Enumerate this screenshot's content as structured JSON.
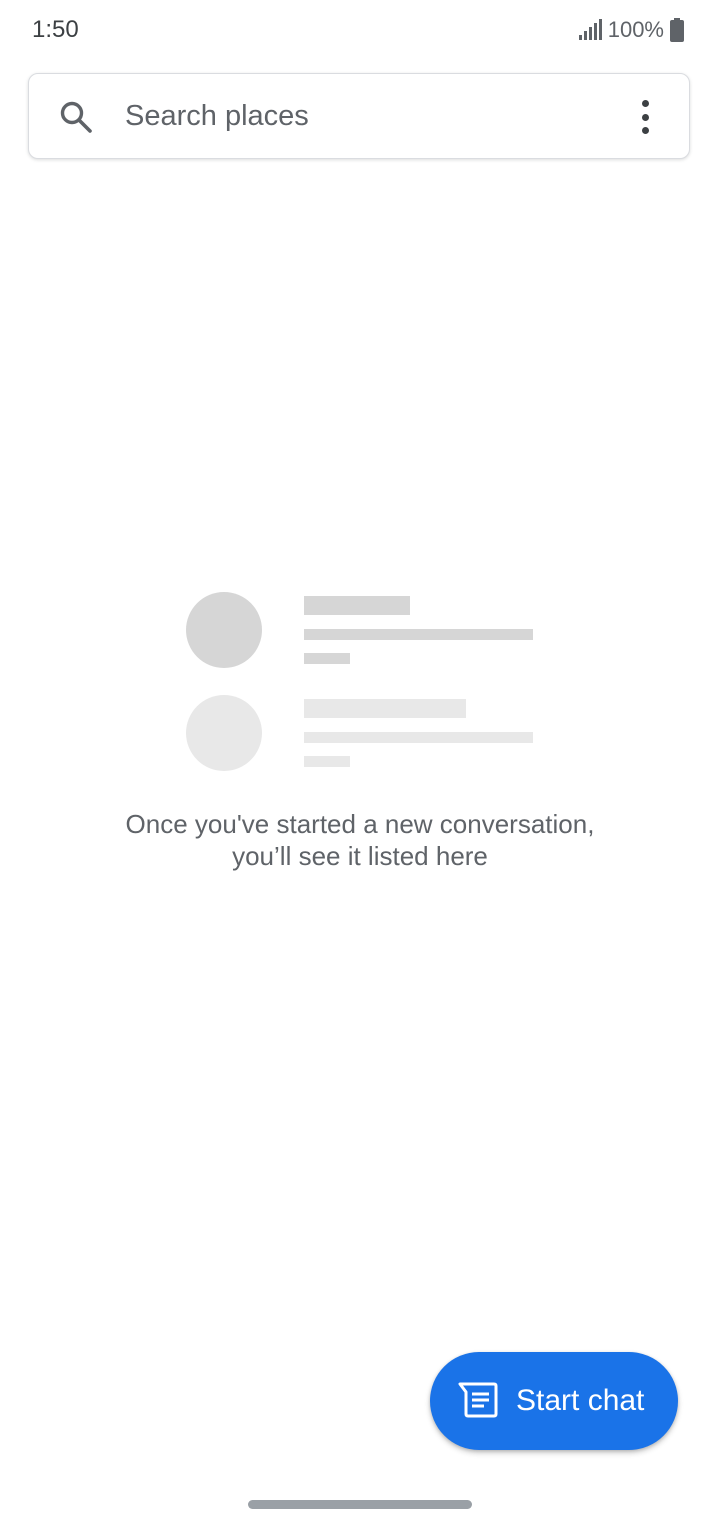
{
  "status_bar": {
    "time": "1:50",
    "battery": "100%",
    "icons": [
      "signal-icon",
      "battery-icon"
    ]
  },
  "search": {
    "placeholder": "Search places",
    "value": "",
    "icon": "search-icon",
    "menu_icon": "more-vert-icon"
  },
  "empty_state": {
    "line1": "Once you've started a new conversation,",
    "line2": "you’ll see it listed here"
  },
  "fab": {
    "label": "Start chat",
    "icon": "chat-icon",
    "color": "#1a73e8"
  }
}
